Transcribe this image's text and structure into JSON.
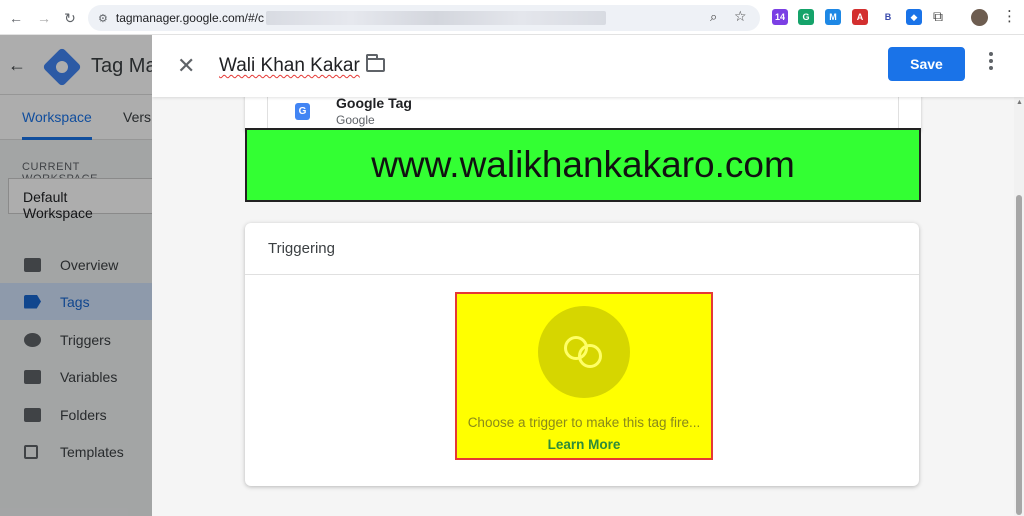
{
  "browser": {
    "url_prefix": "tagmanager.google.com/#/c",
    "extensions": [
      {
        "name": "extension-badge",
        "label": "14",
        "color": "#7b3fe4"
      },
      {
        "name": "grammarly",
        "label": "G",
        "color": "#15a36a"
      },
      {
        "name": "m-ext",
        "label": "M",
        "color": "#1e88e5"
      },
      {
        "name": "pdf-ext",
        "label": "A",
        "color": "#d32f2f"
      },
      {
        "name": "b-ext",
        "label": "B",
        "color": "#3949ab"
      },
      {
        "name": "tag-ext",
        "label": "◆",
        "color": "#1a73e8"
      }
    ]
  },
  "gtm": {
    "title": "Tag Ma",
    "tabs": [
      "Workspace",
      "Vers"
    ],
    "workspace_label": "CURRENT WORKSPACE",
    "workspace_name": "Default Workspace",
    "nav": [
      "Overview",
      "Tags",
      "Triggers",
      "Variables",
      "Folders",
      "Templates"
    ],
    "active_nav": "Tags"
  },
  "panel": {
    "tag_name": "Wali Khan Kakar",
    "save_label": "Save",
    "config": {
      "icon_letter": "G",
      "tag_type": "Google Tag",
      "vendor": "Google"
    },
    "banner_text": "www.walikhankakaro.com",
    "triggering": {
      "title": "Triggering",
      "prompt": "Choose a trigger to make this tag fire...",
      "link": "Learn More"
    }
  },
  "colors": {
    "primary": "#1a73e8",
    "banner_bg": "#33ff33",
    "trigger_highlight": "#ffff00",
    "highlight_border": "#e53935"
  }
}
